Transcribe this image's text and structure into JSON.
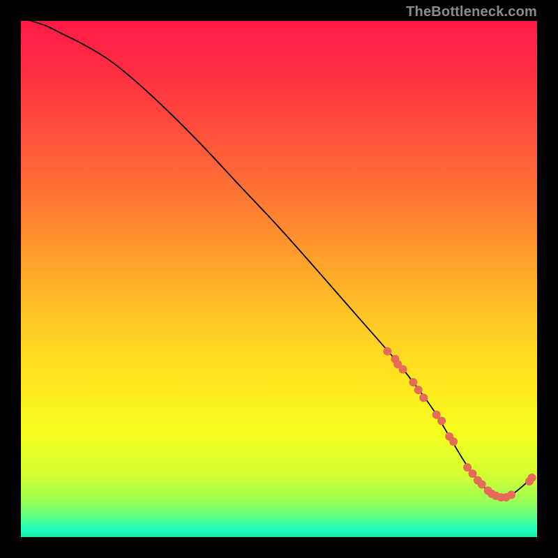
{
  "watermark": "TheBottleneck.com",
  "gradient_stops": [
    {
      "offset": 0.0,
      "color": "#ff1a47"
    },
    {
      "offset": 0.1,
      "color": "#ff2f42"
    },
    {
      "offset": 0.25,
      "color": "#ff5a3a"
    },
    {
      "offset": 0.4,
      "color": "#ff8a2f"
    },
    {
      "offset": 0.55,
      "color": "#ffbf26"
    },
    {
      "offset": 0.7,
      "color": "#ffe81f"
    },
    {
      "offset": 0.8,
      "color": "#f6ff1f"
    },
    {
      "offset": 0.88,
      "color": "#d4ff32"
    },
    {
      "offset": 0.93,
      "color": "#9cff55"
    },
    {
      "offset": 0.965,
      "color": "#52ff8f"
    },
    {
      "offset": 0.985,
      "color": "#20ffc0"
    },
    {
      "offset": 1.0,
      "color": "#17e8a6"
    }
  ],
  "curve_color": "#000000",
  "marker_color": "#e56a58",
  "marker_radius": 6,
  "chart_data": {
    "type": "line",
    "title": "",
    "xlabel": "",
    "ylabel": "",
    "xlim": [
      0,
      100
    ],
    "ylim": [
      0,
      100
    ],
    "series": [
      {
        "name": "bottleneck-curve",
        "x": [
          2,
          5,
          8,
          12,
          17,
          22,
          28,
          35,
          42,
          50,
          58,
          65,
          72,
          76,
          80,
          83,
          86,
          89,
          91,
          93,
          95,
          97,
          99
        ],
        "y": [
          100,
          99,
          97.5,
          95.5,
          92.5,
          88.5,
          83,
          76,
          68.5,
          60,
          51,
          43,
          35,
          30,
          24.5,
          19.5,
          14.5,
          10.5,
          8.5,
          7.7,
          8.2,
          9.7,
          11.5
        ]
      }
    ],
    "markers": {
      "name": "highlighted-points",
      "x": [
        71,
        72.5,
        73,
        74,
        76,
        77,
        78,
        80.5,
        81.5,
        83,
        83.8,
        86.5,
        87.5,
        88.5,
        89.3,
        90.5,
        91.2,
        92,
        93,
        94,
        95,
        98.5,
        99
      ],
      "y": [
        36,
        34.5,
        33.5,
        32.5,
        30,
        28.5,
        27,
        23.7,
        22.5,
        19.5,
        18.5,
        13.5,
        12.3,
        11,
        10.2,
        9,
        8.4,
        8,
        7.7,
        7.7,
        8.2,
        10.8,
        11.5
      ]
    }
  }
}
